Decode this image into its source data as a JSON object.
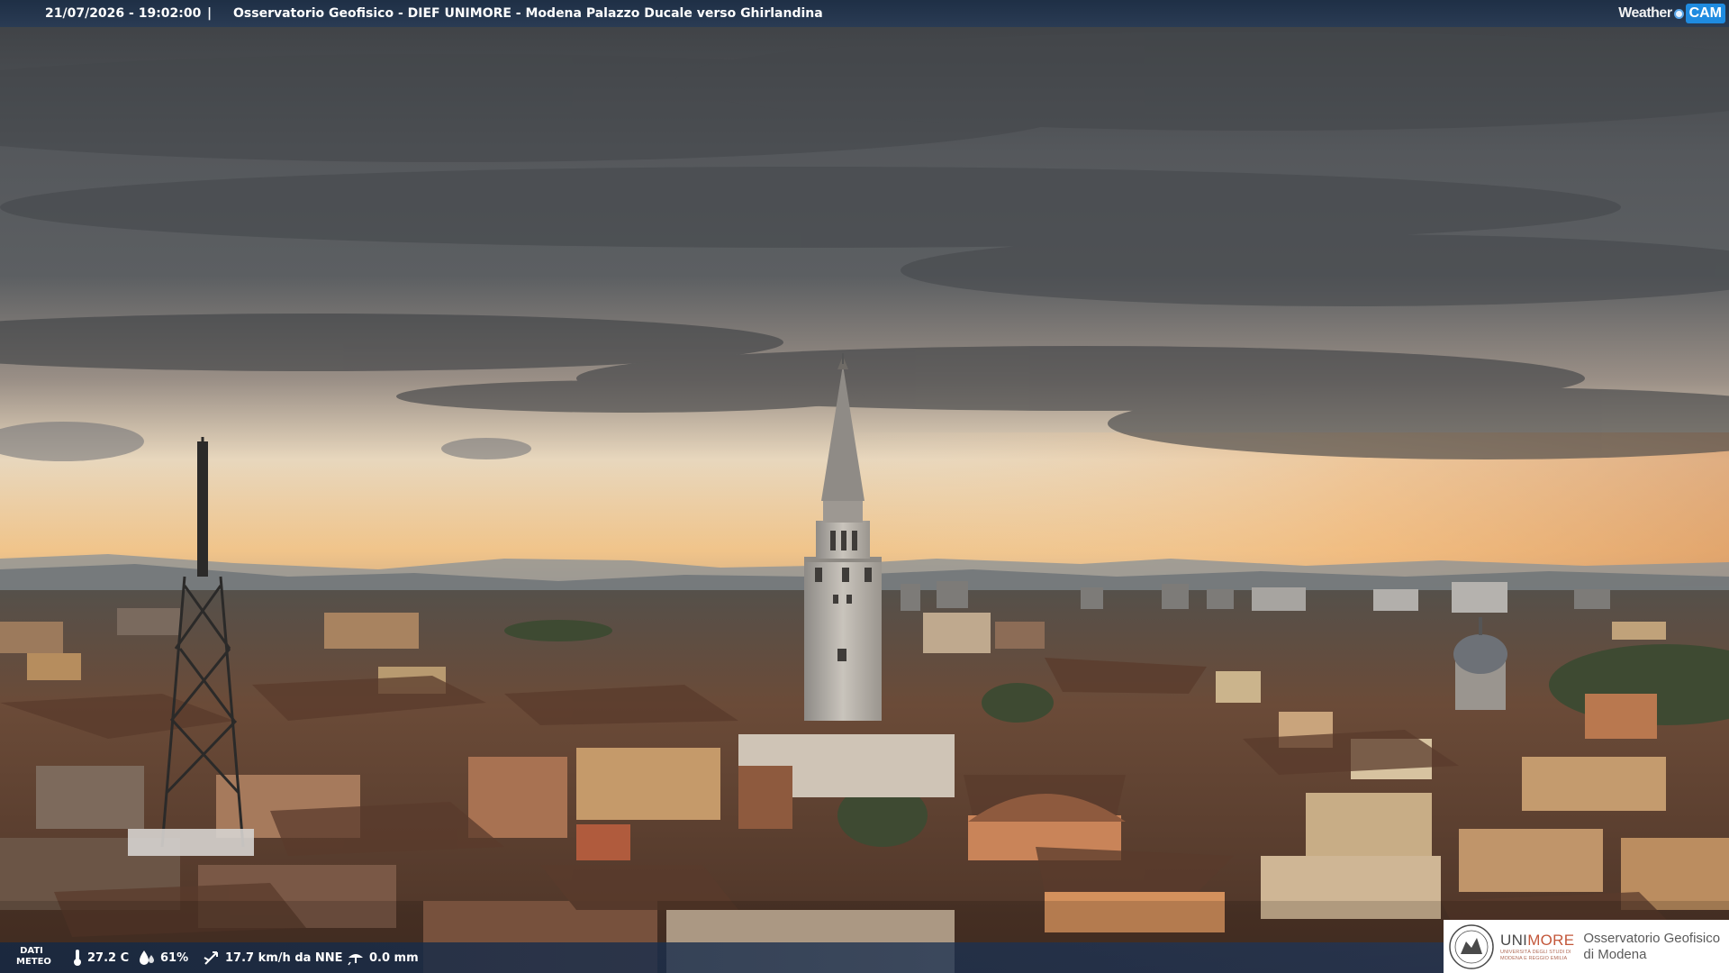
{
  "header": {
    "timestamp": "21/07/2026 - 19:02:00",
    "separator": "|",
    "title": "Osservatorio Geofisico - DIEF UNIMORE - Modena Palazzo Ducale verso Ghirlandina"
  },
  "webcam_logo": {
    "weather": "Weather",
    "cam": "CAM"
  },
  "meteo": {
    "label_line1": "DATI",
    "label_line2": "METEO",
    "temperature": "27.2 C",
    "humidity": "61%",
    "wind": "17.7 km/h da NNE",
    "rain": "0.0 mm",
    "icons": [
      "thermometer-icon",
      "humidity-drop-icon",
      "wind-icon",
      "rain-icon"
    ]
  },
  "institution": {
    "brand_uni": "UNI",
    "brand_more": "MORE",
    "sub_line1": "UNIVERSITÀ DEGLI STUDI DI",
    "sub_line2": "MODENA E REGGIO EMILIA",
    "observatory_line1": "Osservatorio Geofisico",
    "observatory_line2": "di Modena"
  },
  "colors": {
    "sky_top": "#3f4246",
    "horizon_glow": "#f1c98f",
    "roofs": "#6e4a36",
    "bar_blue": "#1f3656",
    "unimore_red": "#c3573a"
  }
}
